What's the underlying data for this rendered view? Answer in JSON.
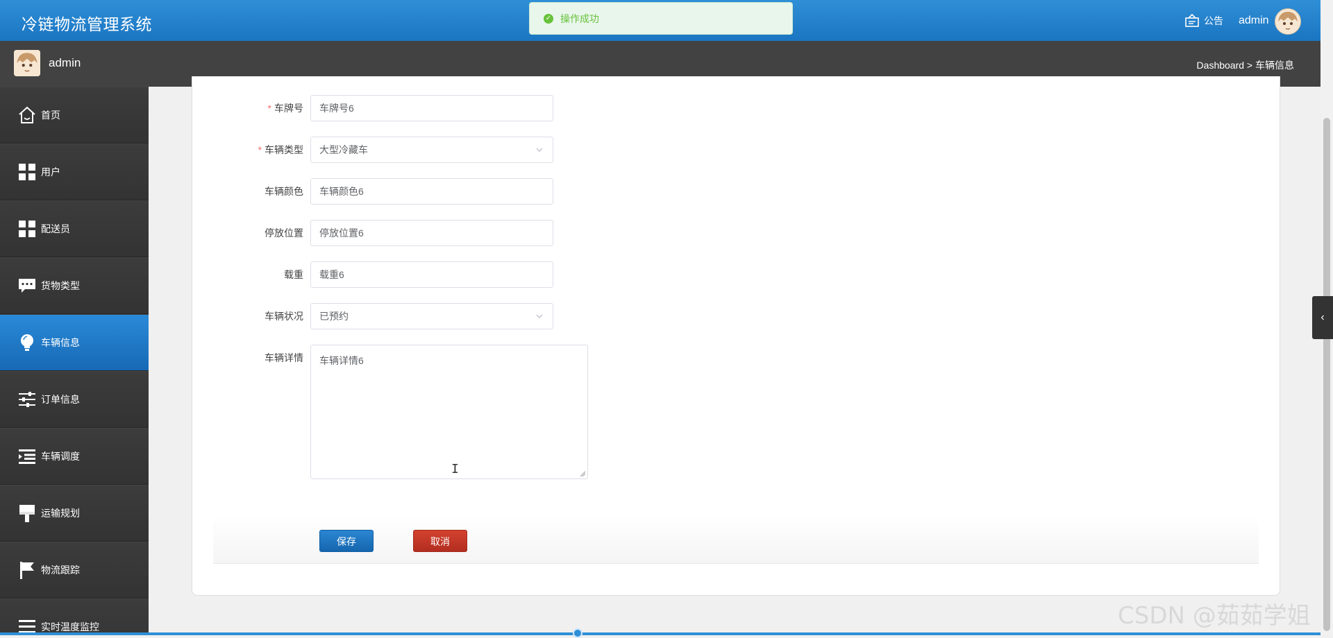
{
  "header": {
    "title": "冷链物流管理系统",
    "notice_label": "公告",
    "username": "admin"
  },
  "toast": {
    "message": "操作成功",
    "type": "success"
  },
  "subbar": {
    "username": "admin",
    "breadcrumb": "Dashboard > 车辆信息"
  },
  "sidebar": {
    "items": [
      {
        "label": "首页",
        "icon": "home-icon"
      },
      {
        "label": "用户",
        "icon": "grid-icon"
      },
      {
        "label": "配送员",
        "icon": "grid-icon"
      },
      {
        "label": "货物类型",
        "icon": "chat-icon"
      },
      {
        "label": "车辆信息",
        "icon": "bulb-icon",
        "active": true
      },
      {
        "label": "订单信息",
        "icon": "sliders-icon"
      },
      {
        "label": "车辆调度",
        "icon": "indent-icon"
      },
      {
        "label": "运输规划",
        "icon": "brush-icon"
      },
      {
        "label": "物流跟踪",
        "icon": "flag-icon"
      },
      {
        "label": "实时温度监控",
        "icon": "thermo-icon"
      }
    ]
  },
  "form": {
    "plate": {
      "label": "车牌号",
      "required": true,
      "value": "车牌号6"
    },
    "type": {
      "label": "车辆类型",
      "required": true,
      "value": "大型冷藏车"
    },
    "color": {
      "label": "车辆颜色",
      "value": "车辆颜色6"
    },
    "parking": {
      "label": "停放位置",
      "value": "停放位置6"
    },
    "load": {
      "label": "载重",
      "value": "载重6"
    },
    "status": {
      "label": "车辆状况",
      "value": "已预约"
    },
    "detail": {
      "label": "车辆详情",
      "value": "车辆详情6"
    }
  },
  "actions": {
    "save": "保存",
    "cancel": "取消"
  },
  "watermark": "CSDN @茹茹学姐",
  "colors": {
    "primary": "#1b75c2",
    "danger": "#b22e20",
    "success": "#67c23a",
    "sidebar": "#333333"
  }
}
